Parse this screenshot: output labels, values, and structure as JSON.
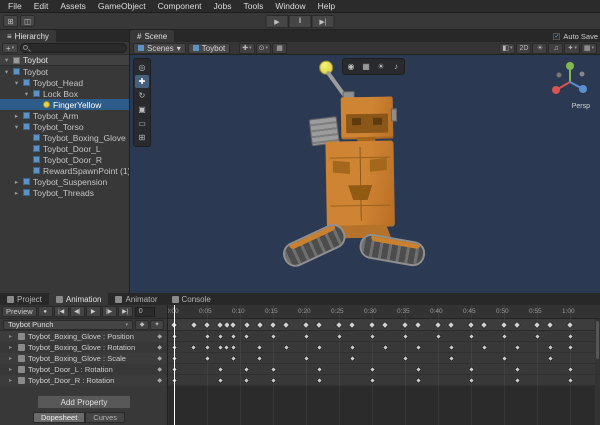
{
  "icons": {
    "dropdown_arrow": "▾",
    "foldout_open": "▾",
    "foldout_closed": "▸",
    "checkmark": "✓",
    "diamond": "◆"
  },
  "menubar": {
    "items": [
      "File",
      "Edit",
      "Assets",
      "GameObject",
      "Component",
      "Jobs",
      "Tools",
      "Window",
      "Help"
    ]
  },
  "main_toolbar": {
    "left_icons": [
      {
        "name": "grid-snap-icon",
        "glyph": "⊞"
      },
      {
        "name": "tool-settings-icon",
        "glyph": "◫"
      }
    ],
    "play_label": "▶",
    "pause_label": "‖",
    "step_label": "▶|"
  },
  "hierarchy": {
    "tab_icon": "≡",
    "tab_label": "Hierarchy",
    "create_label": "+",
    "scene_row": {
      "label": "Toybot"
    },
    "items": [
      {
        "label": "Toybot",
        "indent": 0,
        "arrow": "down"
      },
      {
        "label": "Toybot_Head",
        "indent": 1,
        "arrow": "down"
      },
      {
        "label": "Lock Box",
        "indent": 2,
        "arrow": "down"
      },
      {
        "label": "FingerYellow",
        "indent": 3,
        "arrow": null,
        "icon": "sphere",
        "selected": true
      },
      {
        "label": "Toybot_Arm",
        "indent": 1,
        "arrow": "closed"
      },
      {
        "label": "Toybot_Torso",
        "indent": 1,
        "arrow": "down"
      },
      {
        "label": "Toybot_Boxing_Glove",
        "indent": 2,
        "arrow": null
      },
      {
        "label": "Toybot_Door_L",
        "indent": 2,
        "arrow": null
      },
      {
        "label": "Toybot_Door_R",
        "indent": 2,
        "arrow": null
      },
      {
        "label": "RewardSpawnPoint (1)",
        "indent": 2,
        "arrow": null
      },
      {
        "label": "Toybot_Suspension",
        "indent": 1,
        "arrow": "closed"
      },
      {
        "label": "Toybot_Threads",
        "indent": 1,
        "arrow": "closed"
      }
    ]
  },
  "scene": {
    "tab_icon": "#",
    "tab_label": "Scene",
    "auto_save_label": "Auto Save",
    "breadcrumb": [
      {
        "label": "Scenes",
        "dropdown": true
      },
      {
        "label": "Toybot",
        "dropdown": false
      }
    ],
    "toolbar_center_icons": [
      {
        "name": "tool-handle-position-icon",
        "glyph": "✚",
        "dropdown": true
      },
      {
        "name": "tool-handle-rotation-icon",
        "glyph": "⊙",
        "dropdown": true
      },
      {
        "name": "snap-settings-icon",
        "glyph": "▦",
        "dropdown": false
      }
    ],
    "toolbar_right_icons": [
      {
        "name": "shading-mode-icon",
        "glyph": "◧",
        "dropdown": true
      },
      {
        "name": "2d-toggle",
        "glyph": "2D",
        "dropdown": false
      },
      {
        "name": "lighting-toggle-icon",
        "glyph": "☀",
        "dropdown": false
      },
      {
        "name": "audio-toggle-icon",
        "glyph": "♫",
        "dropdown": false
      },
      {
        "name": "effects-icon",
        "glyph": "✦",
        "dropdown": true
      },
      {
        "name": "grid-icon",
        "glyph": "▦",
        "dropdown": true
      }
    ],
    "view_overlay_icons": [
      {
        "name": "camera-settings-icon",
        "glyph": "◉"
      },
      {
        "name": "grid-overlay-icon",
        "glyph": "▦"
      },
      {
        "name": "light-overlay-icon",
        "glyph": "☀"
      },
      {
        "name": "audio-overlay-icon",
        "glyph": "♪"
      }
    ],
    "tools_overlay_icons": [
      {
        "name": "view-tool-icon",
        "glyph": "◎",
        "active": false
      },
      {
        "name": "move-tool-icon",
        "glyph": "✚",
        "active": true
      },
      {
        "name": "rotate-tool-icon",
        "glyph": "↻",
        "active": false
      },
      {
        "name": "scale-tool-icon",
        "glyph": "▣",
        "active": false
      },
      {
        "name": "rect-tool-icon",
        "glyph": "▭",
        "active": false
      },
      {
        "name": "transform-tool-icon",
        "glyph": "⊞",
        "active": false
      }
    ],
    "persp_label": "Persp",
    "gizmo_colors": {
      "x": "#d9534f",
      "y": "#84b84c",
      "z": "#5a8fd0"
    },
    "background": "#2b3a52"
  },
  "animation": {
    "tabs": [
      {
        "label": "Project"
      },
      {
        "label": "Animation"
      },
      {
        "label": "Animator"
      },
      {
        "label": "Console"
      }
    ],
    "active_tab": "Animation",
    "preview_label": "Preview",
    "transport_icons": [
      {
        "name": "record-button",
        "glyph": "●"
      },
      {
        "name": "first-key-button",
        "glyph": "|◀"
      },
      {
        "name": "prev-key-button",
        "glyph": "◀|"
      },
      {
        "name": "play-button",
        "glyph": "▶"
      },
      {
        "name": "next-key-button",
        "glyph": "|▶"
      },
      {
        "name": "last-key-button",
        "glyph": "▶|"
      }
    ],
    "frame_value": "0",
    "clip_name": "Toybot Punch",
    "clip_buttons": [
      {
        "name": "add-keyframe-button",
        "glyph": "◆"
      },
      {
        "name": "add-event-button",
        "glyph": "✦"
      }
    ],
    "properties": [
      "Toybot_Boxing_Glove : Position",
      "Toybot_Boxing_Glove : Rotation",
      "Toybot_Boxing_Glove : Scale",
      "Toybot_Door_L : Rotation",
      "Toybot_Door_R : Rotation"
    ],
    "add_property_label": "Add Property",
    "dopesheet_label": "Dopesheet",
    "curves_label": "Curves",
    "ruler_labels": [
      "0:00",
      "0:05",
      "0:10",
      "0:15",
      "0:20",
      "0:25",
      "0:30",
      "0:35",
      "0:40",
      "0:45",
      "0:50",
      "0:55",
      "1:00"
    ],
    "frames_per_label": 5,
    "keyframes": {
      "summary": [
        0,
        3,
        5,
        7,
        8,
        9,
        11,
        13,
        15,
        17,
        20,
        22,
        25,
        27,
        30,
        32,
        35,
        37,
        40,
        42,
        45,
        47,
        50,
        52,
        55,
        57,
        60
      ],
      "rows": [
        [
          0,
          5,
          7,
          9,
          11,
          15,
          20,
          25,
          30,
          35,
          40,
          45,
          50,
          55,
          60
        ],
        [
          0,
          3,
          5,
          7,
          8,
          9,
          13,
          17,
          22,
          27,
          32,
          37,
          42,
          47,
          52,
          57,
          60
        ],
        [
          0,
          5,
          9,
          13,
          20,
          27,
          35,
          42,
          50,
          57
        ],
        [
          0,
          7,
          11,
          15,
          22,
          30,
          37,
          45,
          52,
          60
        ],
        [
          0,
          7,
          11,
          15,
          22,
          30,
          37,
          45,
          52,
          60
        ]
      ]
    }
  }
}
